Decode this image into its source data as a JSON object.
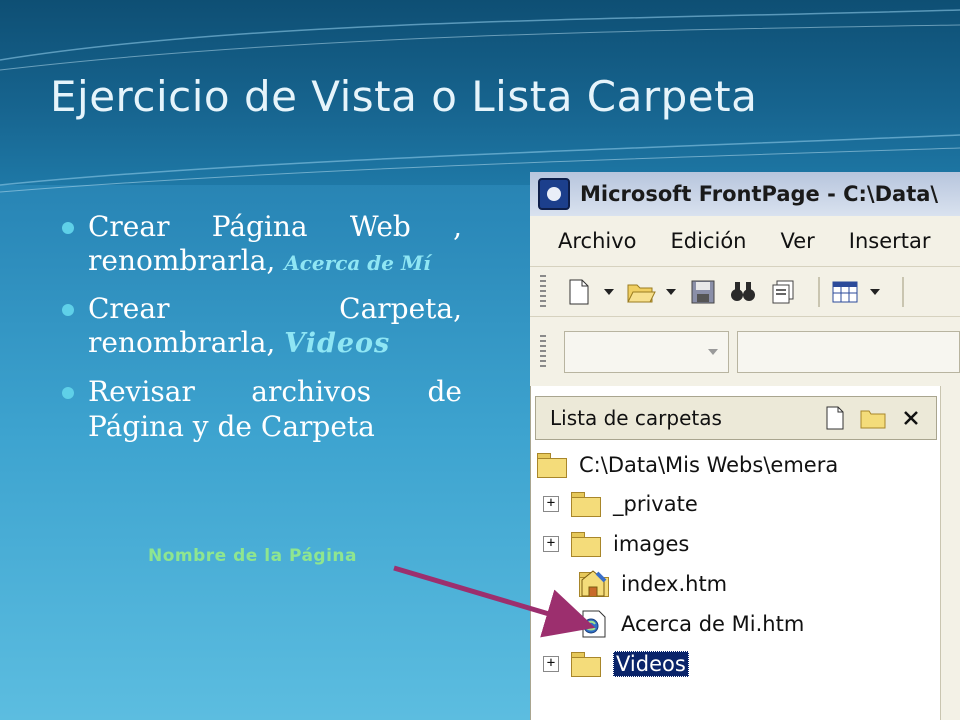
{
  "slide": {
    "title": "Ejercicio de Vista o Lista Carpeta",
    "bullets": [
      {
        "text": "Crear Página Web , renombrarla, ",
        "highlight": "Acerca de Mí"
      },
      {
        "text": "Crear Carpeta, renombrarla, ",
        "highlight": "Videos"
      },
      {
        "text": "Revisar archivos de Página y de Carpeta",
        "highlight": ""
      }
    ],
    "caption": "Nombre de la Página"
  },
  "window": {
    "title": "Microsoft FrontPage - C:\\Data\\",
    "menu": [
      "Archivo",
      "Edición",
      "Ver",
      "Insertar"
    ],
    "toolbar_icons": [
      "new-page-icon",
      "open-folder-icon",
      "save-icon",
      "find-icon",
      "preview-icon",
      "table-icon"
    ],
    "panel": {
      "title": "Lista de carpetas",
      "tree": [
        {
          "name": "C:\\Data\\Mis Webs\\emera",
          "type": "folder",
          "expandable": false,
          "selected": false
        },
        {
          "name": "_private",
          "type": "folder",
          "expandable": true,
          "selected": false
        },
        {
          "name": "images",
          "type": "folder",
          "expandable": true,
          "selected": false
        },
        {
          "name": "index.htm",
          "type": "home-page",
          "expandable": false,
          "selected": false
        },
        {
          "name": "Acerca de Mi.htm",
          "type": "page",
          "expandable": false,
          "selected": false
        },
        {
          "name": "Videos",
          "type": "folder",
          "expandable": true,
          "selected": true
        }
      ]
    }
  },
  "colors": {
    "title": "#e6f4fb",
    "highlight": "#8fe6f4",
    "caption": "#8fe68f",
    "arrow": "#9c2f6e"
  }
}
